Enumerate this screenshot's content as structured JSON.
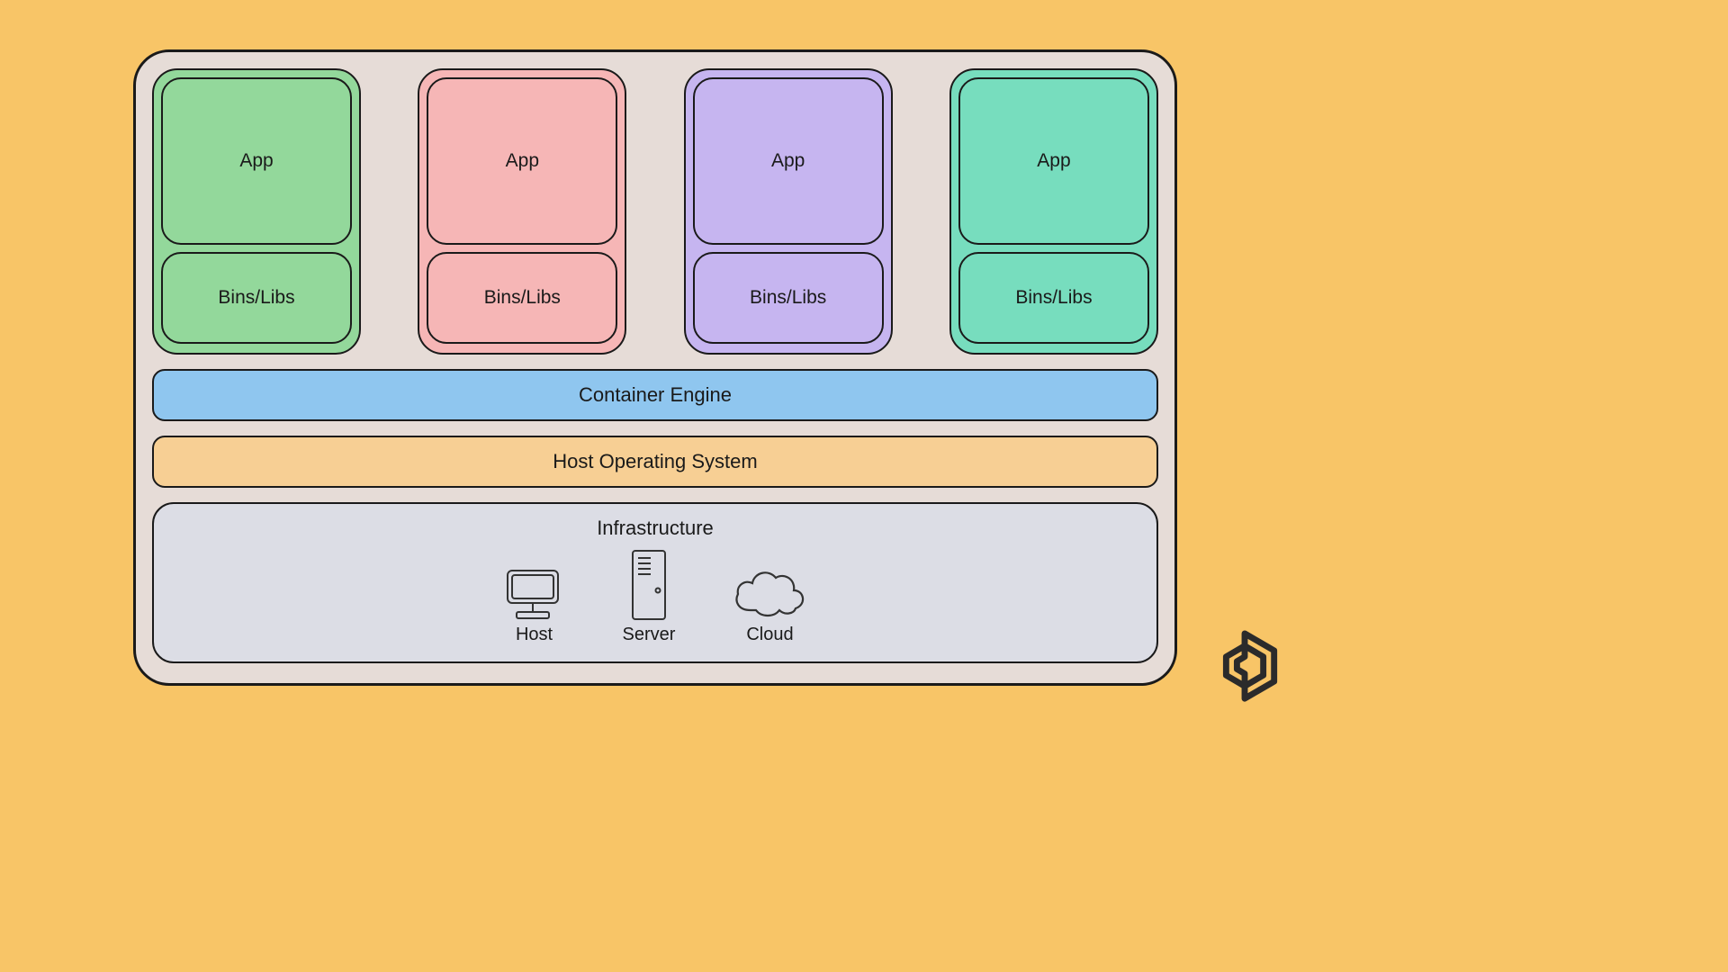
{
  "containers": [
    {
      "app": "App",
      "libs": "Bins/Libs",
      "color": "#93d89b"
    },
    {
      "app": "App",
      "libs": "Bins/Libs",
      "color": "#f6b6b6"
    },
    {
      "app": "App",
      "libs": "Bins/Libs",
      "color": "#c6b5f0"
    },
    {
      "app": "App",
      "libs": "Bins/Libs",
      "color": "#77ddbe"
    }
  ],
  "layers": {
    "engine": "Container Engine",
    "host_os": "Host Operating System",
    "infrastructure": {
      "title": "Infrastructure",
      "items": [
        {
          "name": "host",
          "label": "Host"
        },
        {
          "name": "server",
          "label": "Server"
        },
        {
          "name": "cloud",
          "label": "Cloud"
        }
      ]
    }
  }
}
